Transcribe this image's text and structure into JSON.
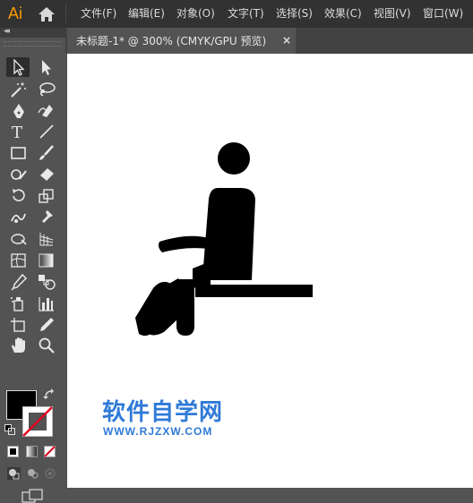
{
  "app": {
    "logo": "Ai"
  },
  "menu": [
    "文件(F)",
    "编辑(E)",
    "对象(O)",
    "文字(T)",
    "选择(S)",
    "效果(C)",
    "视图(V)",
    "窗口(W)"
  ],
  "toolbar": {
    "collapse": "◂◂",
    "type_glyph": "T"
  },
  "document_tab": {
    "title": "未标题-1* @ 300% (CMYK/GPU 预览)",
    "close": "×"
  },
  "colors": {
    "accent": "#ff9a00",
    "fill": "#000000",
    "stroke": "none",
    "watermark": "#2f7ad8"
  },
  "watermark": {
    "title": "软件自学网",
    "url": "WWW.RJZXW.COM"
  }
}
